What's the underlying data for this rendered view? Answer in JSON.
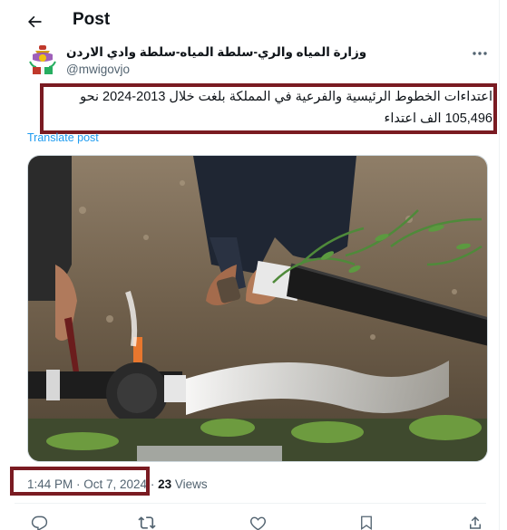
{
  "header": {
    "title": "Post",
    "back_icon": "arrow-left-icon"
  },
  "author": {
    "name": "وزارة المياه والري-سلطة المياه-سلطة وادي الاردن",
    "handle": "@mwigovjo",
    "avatar_icon": "jordan-coat-of-arms-icon",
    "more_icon": "more-horizontal-icon"
  },
  "post": {
    "text": "اعتداءات الخطوط الرئيسية والفرعية في المملكة بلغت خلال 2013-2024 نحو\n105,496 الف اعتداء",
    "translate_label": "Translate post",
    "media_description_icon": "photo-icon"
  },
  "meta": {
    "timestamp": "1:44 PM · Oct 7, 2024",
    "separator": " · ",
    "views_count": "23",
    "views_label": "Views"
  },
  "actions": [
    {
      "icon": "reply-icon"
    },
    {
      "icon": "repost-icon"
    },
    {
      "icon": "like-icon"
    },
    {
      "icon": "bookmark-icon"
    },
    {
      "icon": "share-icon"
    }
  ],
  "colors": {
    "highlight_box": "#7a1b22",
    "link": "#1d9bf0",
    "secondary_text": "#536471"
  }
}
